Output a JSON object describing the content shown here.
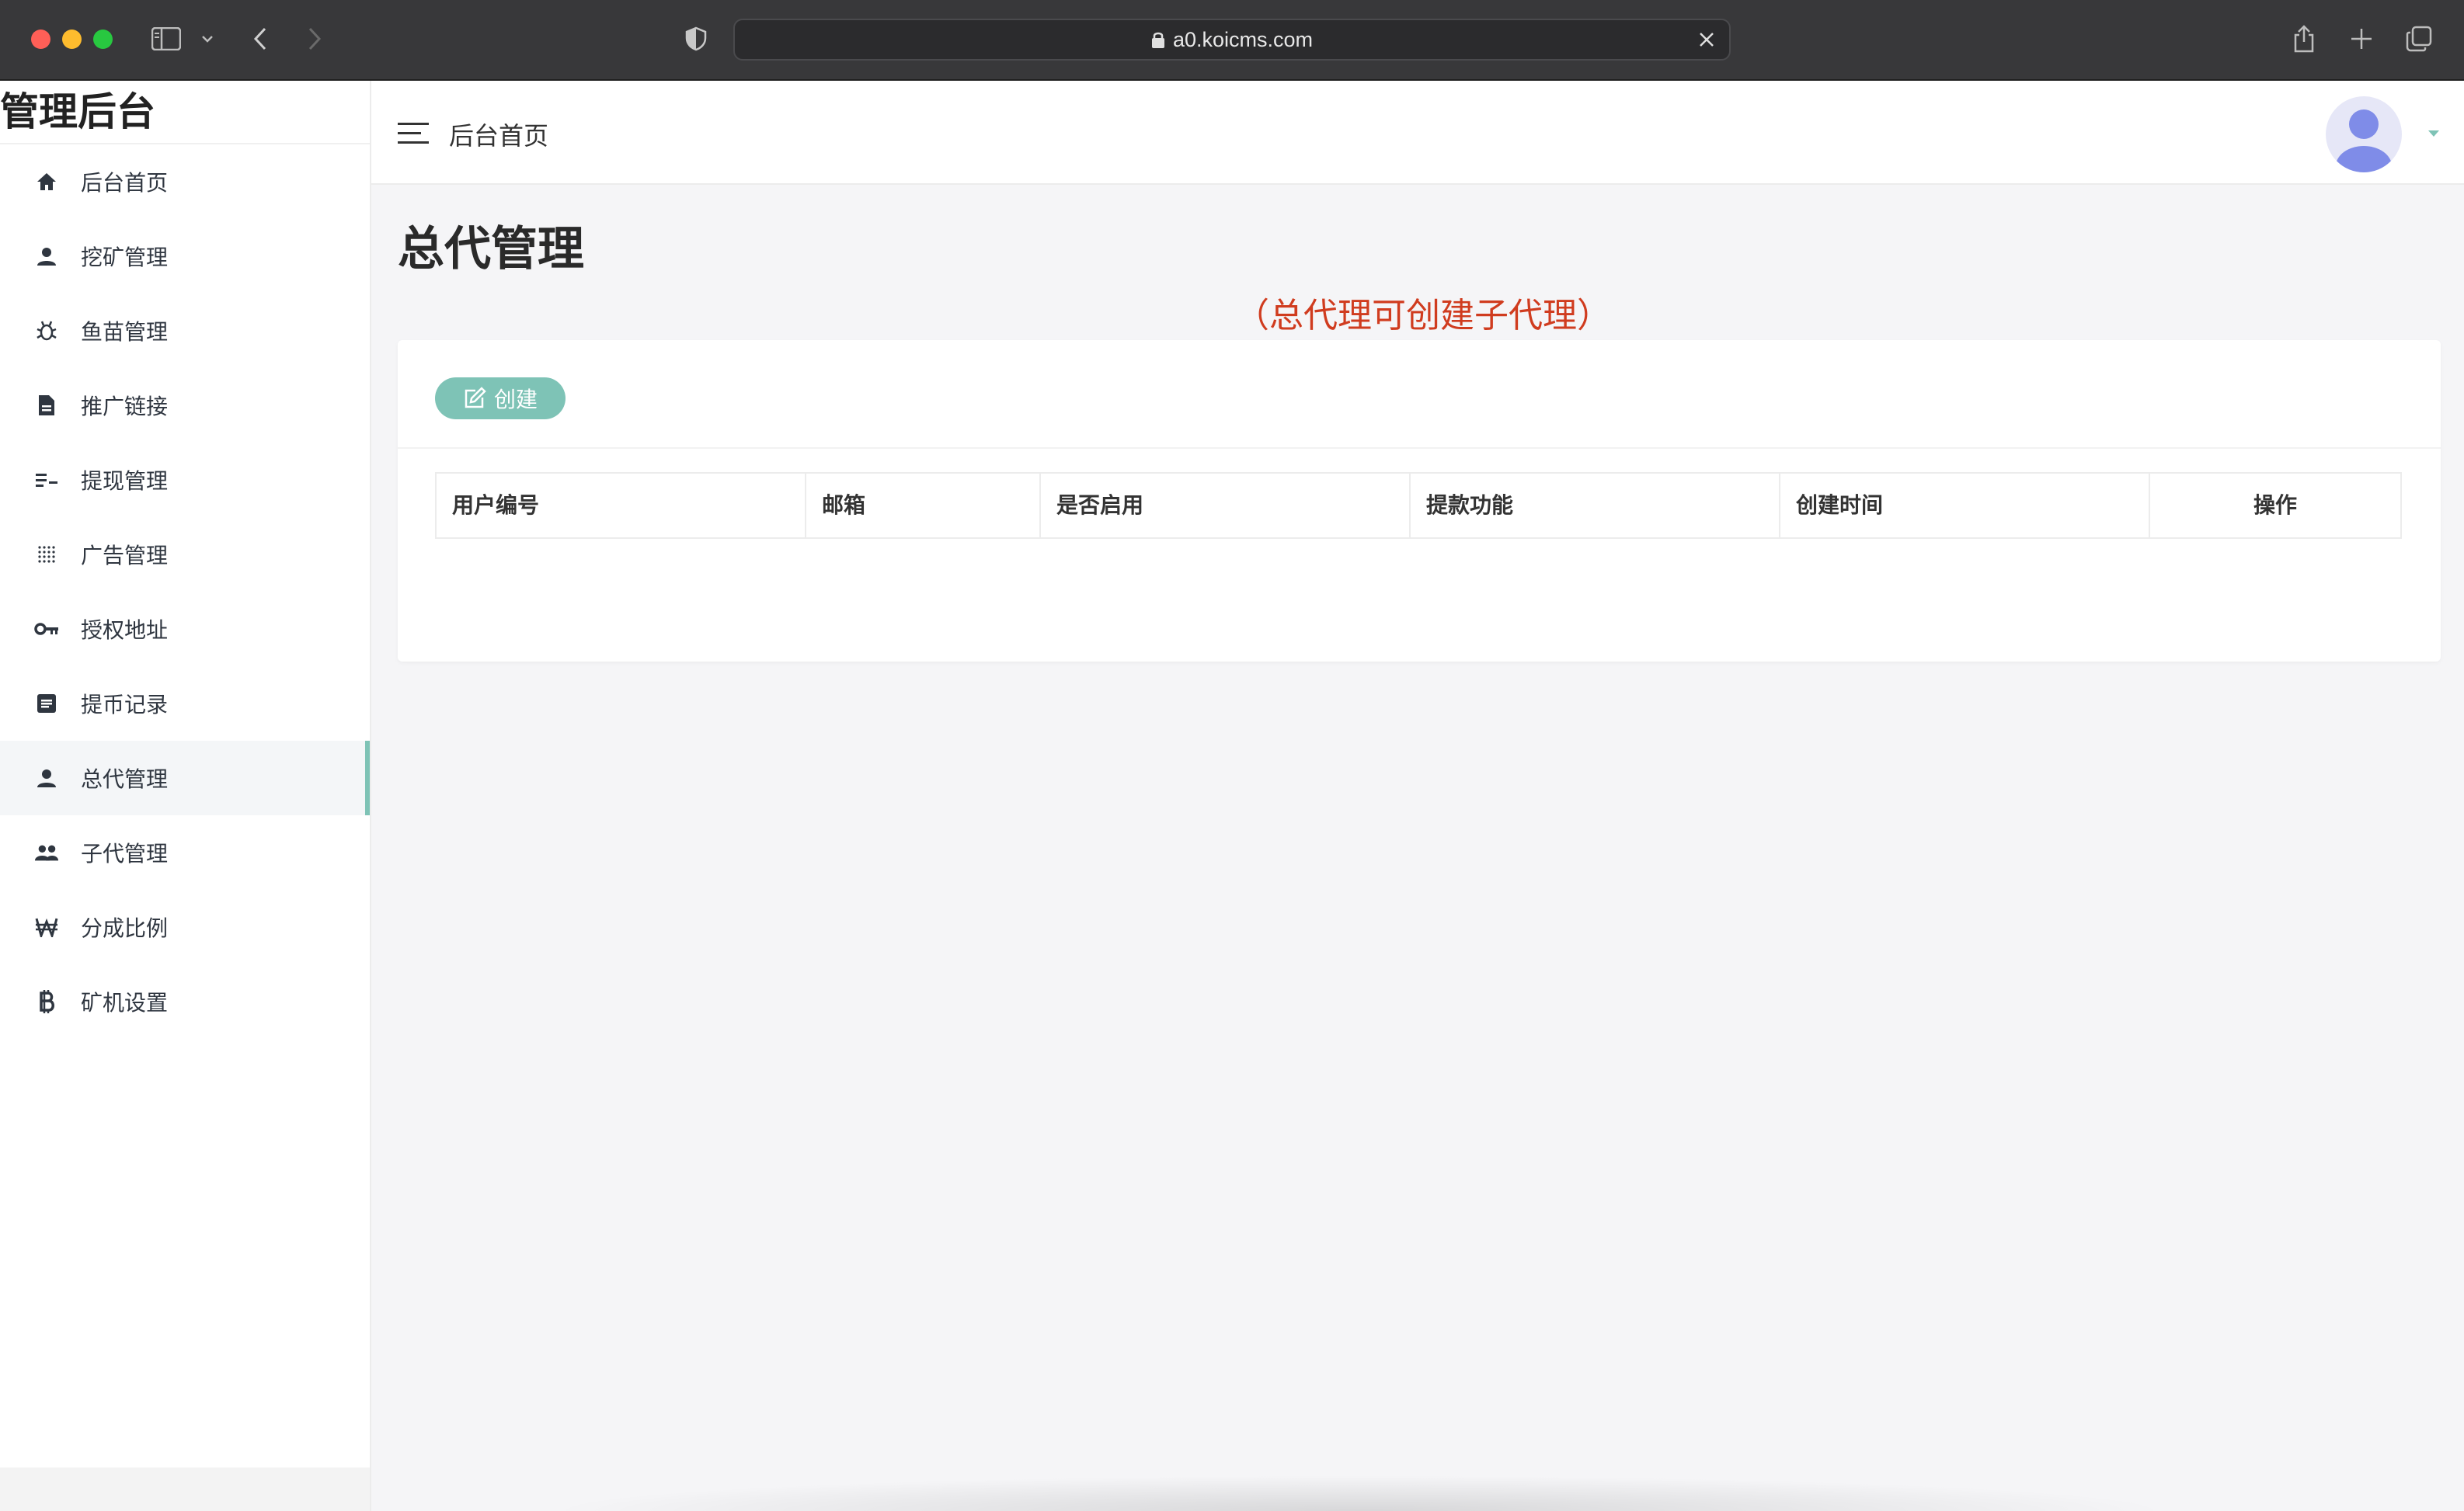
{
  "browser": {
    "url": "a0.koicms.com"
  },
  "sidebar": {
    "brand": "管理后台",
    "items": [
      {
        "label": "后台首页",
        "icon": "home-icon"
      },
      {
        "label": "挖矿管理",
        "icon": "user-icon"
      },
      {
        "label": "鱼苗管理",
        "icon": "bug-icon"
      },
      {
        "label": "推广链接",
        "icon": "document-icon"
      },
      {
        "label": "提现管理",
        "icon": "list-icon"
      },
      {
        "label": "广告管理",
        "icon": "dots-grid-icon"
      },
      {
        "label": "授权地址",
        "icon": "key-icon"
      },
      {
        "label": "提币记录",
        "icon": "record-icon"
      },
      {
        "label": "总代管理",
        "icon": "user-icon",
        "active": true
      },
      {
        "label": "子代管理",
        "icon": "group-icon"
      },
      {
        "label": "分成比例",
        "icon": "won-icon"
      },
      {
        "label": "矿机设置",
        "icon": "bitcoin-icon"
      }
    ]
  },
  "header": {
    "breadcrumb": "后台首页"
  },
  "main": {
    "title": "总代管理",
    "note": "（总代理可创建子代理）",
    "create_label": "创建",
    "columns": [
      "用户编号",
      "邮箱",
      "是否启用",
      "提款功能",
      "创建时间",
      "操作"
    ]
  },
  "colors": {
    "accent": "#7ec3b6",
    "note_red": "#d03c1f",
    "chrome": "#38383a"
  }
}
